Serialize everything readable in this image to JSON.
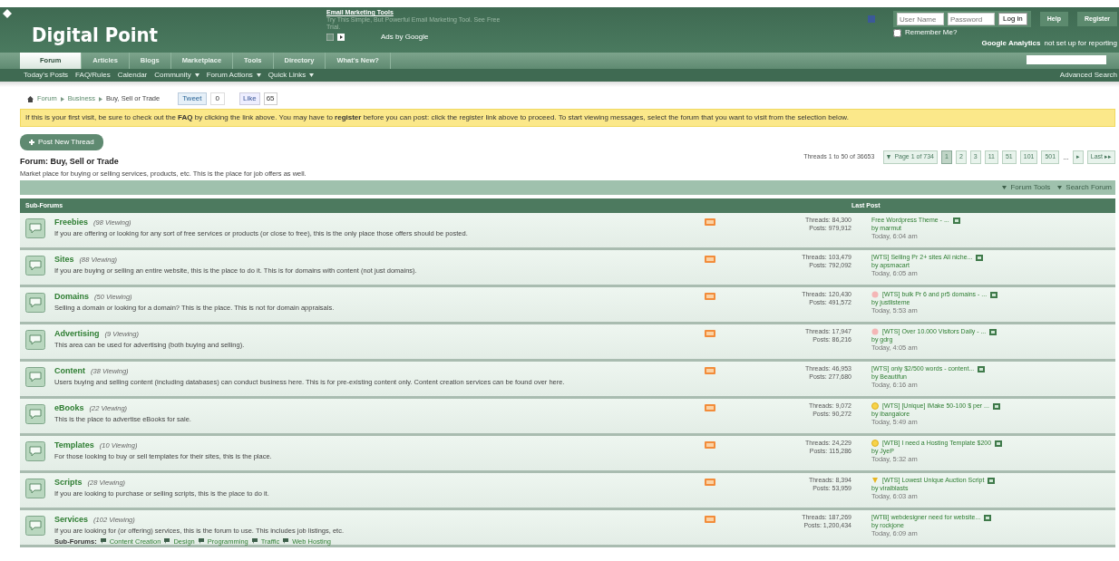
{
  "header": {
    "logo": "Digital Point",
    "ad": {
      "title": "Email Marketing Tools",
      "text": "Try This Simple, But Powerful Email Marketing Tool. See Free Trial.",
      "attribution": "Ads by Google"
    },
    "login": {
      "username_placeholder": "User Name",
      "password_placeholder": "Password",
      "button": "Log in",
      "remember": "Remember Me?",
      "remember_checked": false
    },
    "buttons": [
      "Help",
      "Register"
    ],
    "analytics_label": "Google Analytics",
    "analytics_note": "not set up for reporting"
  },
  "tabs": [
    {
      "label": "Forum",
      "selected": true
    },
    {
      "label": "Articles",
      "selected": false
    },
    {
      "label": "Blogs",
      "selected": false
    },
    {
      "label": "Marketplace",
      "selected": false
    },
    {
      "label": "Tools",
      "selected": false
    },
    {
      "label": "Directory",
      "selected": false
    },
    {
      "label": "What's New?",
      "selected": false
    }
  ],
  "subnav": [
    {
      "label": "Today's Posts",
      "dropdown": false
    },
    {
      "label": "FAQ/Rules",
      "dropdown": false
    },
    {
      "label": "Calendar",
      "dropdown": false
    },
    {
      "label": "Community",
      "dropdown": true
    },
    {
      "label": "Forum Actions",
      "dropdown": true
    },
    {
      "label": "Quick Links",
      "dropdown": true
    }
  ],
  "advanced_search": "Advanced Search",
  "breadcrumbs": [
    "Forum",
    "Business",
    "Buy, Sell or Trade"
  ],
  "social": {
    "tweet": "Tweet",
    "tweet_count": "0",
    "like": "Like",
    "like_count": "65"
  },
  "notice": "If this is your first visit, be sure to check out the **FAQ** by clicking the link above. You may have to **register** before you can post: click the register link above to proceed. To start viewing messages, select the forum that you want to visit from the selection below.",
  "post_button": "Post New Thread",
  "forum": {
    "title": "Forum: Buy, Sell or Trade",
    "description": "Market place for buying or selling services, products, etc. This is the place for job offers as well."
  },
  "pagination": {
    "summary": "Threads 1 to 50 of 36653",
    "page_label": "Page 1 of 734",
    "pages": [
      {
        "label": "1",
        "selected": true
      },
      {
        "label": "2",
        "selected": false
      },
      {
        "label": "3",
        "selected": false
      },
      {
        "label": "11",
        "selected": false
      },
      {
        "label": "51",
        "selected": false
      },
      {
        "label": "101",
        "selected": false
      },
      {
        "label": "501",
        "selected": false
      }
    ],
    "ellipsis": "...",
    "next": "▸",
    "last": "Last ▸▸"
  },
  "toolbar": [
    "Forum Tools",
    "Search Forum"
  ],
  "table": {
    "columns": [
      "Sub-Forums",
      "Last Post"
    ],
    "rows": [
      {
        "title": "Freebies",
        "viewing": "(98 Viewing)",
        "description": "If you are offering or looking for any sort of free services or products (or close to free), this is the only place those offers should be posted.",
        "threads": "Threads: 84,300",
        "posts": "Posts: 979,912",
        "last_title": "Free Wordpress Theme - ...",
        "last_by": "by marmut",
        "last_time": "Today, 6:04 am"
      },
      {
        "title": "Sites",
        "viewing": "(88 Viewing)",
        "description": "If you are buying or selling an entire website, this is the place to do it. This is for domains with content (not just domains).",
        "threads": "Threads: 103,479",
        "posts": "Posts: 792,092",
        "last_title": "[WTS] Selling Pr 2+ sites All niche...",
        "last_by": "by apsmacart",
        "last_time": "Today, 6:05 am"
      },
      {
        "title": "Domains",
        "viewing": "(50 Viewing)",
        "description": "Selling a domain or looking for a domain? This is the place. This is not for domain appraisals.",
        "threads": "Threads: 120,430",
        "posts": "Posts: 491,572",
        "last_title": "[WTS] bulk Pr 6 and pr5 domains - ...",
        "last_by": "by justlisteme",
        "last_time": "Today, 5:53 am",
        "kind": "alert"
      },
      {
        "title": "Advertising",
        "viewing": "(9 Viewing)",
        "description": "This area can be used for advertising (both buying and selling).",
        "threads": "Threads: 17,947",
        "posts": "Posts: 86,216",
        "last_title": "[WTS] Over 10.000 Visitors Daily - ...",
        "last_by": "by gdrg",
        "last_time": "Today, 4:05 am",
        "kind": "alert"
      },
      {
        "title": "Content",
        "viewing": "(38 Viewing)",
        "description": "Users buying and selling content (including databases) can conduct business here. This is for pre-existing content only. Content creation services can be found over here.",
        "threads": "Threads: 46,953",
        "posts": "Posts: 277,680",
        "last_title": "[WTS] only $2/500 words - content...",
        "last_by": "by Beautifun",
        "last_time": "Today, 6:16 am"
      },
      {
        "title": "eBooks",
        "viewing": "(22 Viewing)",
        "description": "This is the place to advertise eBooks for sale.",
        "threads": "Threads: 9,072",
        "posts": "Posts: 90,272",
        "last_title": "[WTS] [Unique] IMake 50-100 $ per ...",
        "last_by": "by ibangalore",
        "last_time": "Today, 5:49 am",
        "kind": "smile"
      },
      {
        "title": "Templates",
        "viewing": "(10 Viewing)",
        "description": "For those looking to buy or sell templates for their sites, this is the place.",
        "threads": "Threads: 24,229",
        "posts": "Posts: 115,286",
        "last_title": "[WTB] I need a Hosting Template $200",
        "last_by": "by JyeP",
        "last_time": "Today, 5:32 am",
        "kind": "smile"
      },
      {
        "title": "Scripts",
        "viewing": "(28 Viewing)",
        "description": "If you are looking to purchase or selling scripts, this is the place to do it.",
        "threads": "Threads: 8,394",
        "posts": "Posts: 53,959",
        "last_title": "[WTS] Lowest Unique Auction Script",
        "last_by": "by viralblasts",
        "last_time": "Today, 6:03 am",
        "kind": "bulb"
      },
      {
        "title": "Services",
        "viewing": "(102 Viewing)",
        "description": "If you are looking for (or offering) services, this is the forum to use. This includes job listings, etc.",
        "subforums_label": "Sub-Forums:",
        "subforums": [
          "Content Creation",
          "Design",
          "Programming",
          "Traffic",
          "Web Hosting"
        ],
        "threads": "Threads: 187,269",
        "posts": "Posts: 1,200,434",
        "last_title": "[WTB] webdesigner need for website...",
        "last_by": "by rockjone",
        "last_time": "Today, 6:09 am"
      }
    ]
  }
}
